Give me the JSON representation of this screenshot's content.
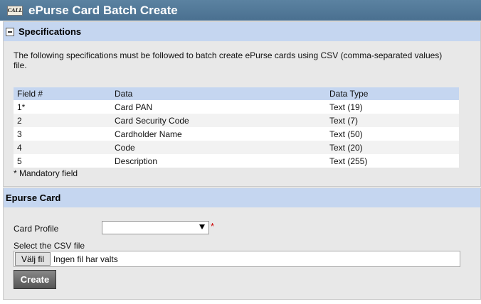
{
  "window": {
    "title": "ePurse Card Batch Create",
    "logo_text": "CALL"
  },
  "specifications": {
    "header": "Specifications",
    "description": "The following specifications must be followed to batch create ePurse cards using CSV (comma-separated values) file.",
    "columns": [
      "Field #",
      "Data",
      "Data Type"
    ],
    "rows": [
      [
        "1*",
        "Card PAN",
        "Text (19)"
      ],
      [
        "2",
        "Card Security Code",
        "Text (7)"
      ],
      [
        "3",
        "Cardholder Name",
        "Text (50)"
      ],
      [
        "4",
        "Code",
        "Text (20)"
      ],
      [
        "5",
        "Description",
        "Text (255)"
      ]
    ],
    "mandatory_note": "* Mandatory field"
  },
  "epurse_card": {
    "header": "Epurse Card",
    "card_profile_label": "Card Profile",
    "card_profile_value": "",
    "required_marker": "*",
    "csv_label": "Select the CSV file",
    "file_button_label": "Välj fil",
    "file_status": "Ingen fil har valts",
    "create_label": "Create"
  },
  "colors": {
    "title_bar": "#4f7696",
    "section_header": "#c5d6f0",
    "panel_bg": "#e8e8e8",
    "required": "#cc0000"
  }
}
